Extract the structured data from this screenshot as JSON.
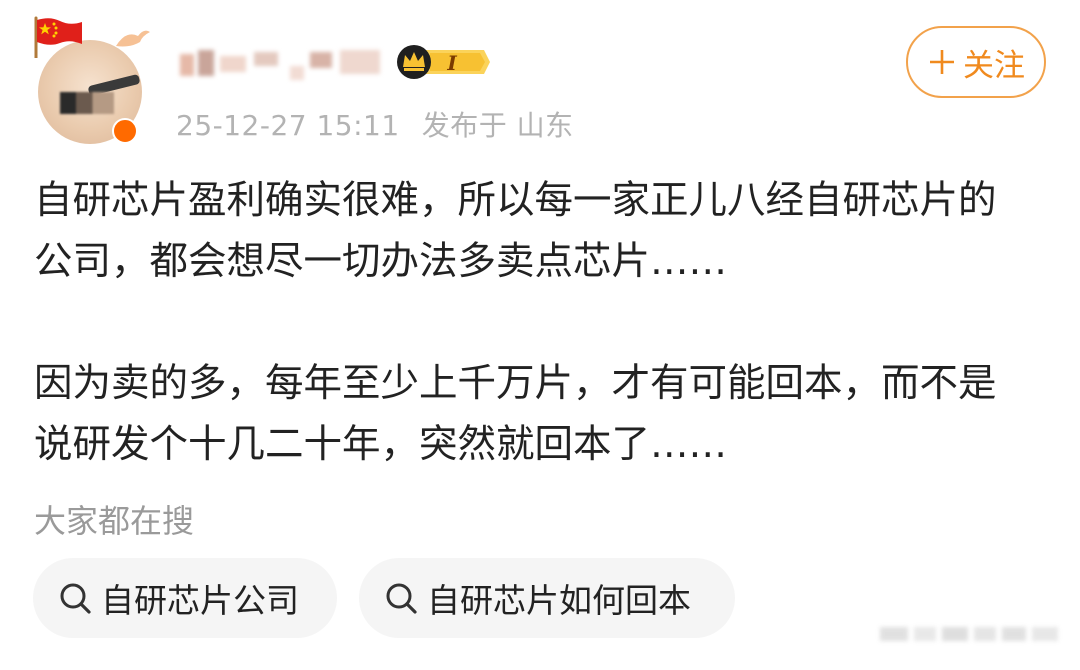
{
  "post": {
    "meta": {
      "date": "25-12-27 15:11",
      "location": "发布于 山东"
    },
    "follow_button": {
      "label": "关注",
      "icon": "plus-icon"
    },
    "badge": {
      "icon": "crown-icon",
      "level_text": "I"
    },
    "paragraphs": [
      {
        "lines": [
          "自研芯片盈利确实很难，所以每一家正儿八经自研芯片的",
          "公司，都会想尽一切办法多卖点芯片……"
        ]
      },
      {
        "lines": [
          "因为卖的多，每年至少上千万片，才有可能回本，而不是",
          "说研发个十几二十年，突然就回本了……"
        ]
      }
    ]
  },
  "search_section": {
    "title": "大家都在搜",
    "chips": [
      {
        "label": "自研芯片公司",
        "icon": "search-icon"
      },
      {
        "label": "自研芯片如何回本",
        "icon": "search-icon"
      }
    ]
  },
  "colors": {
    "accent_orange": "#f08a1e",
    "follow_border": "#f2a24b",
    "meta_text": "#b3b3b3",
    "chip_bg": "#f5f5f5",
    "flag_red": "#e0201a",
    "flag_star": "#ffd200"
  }
}
